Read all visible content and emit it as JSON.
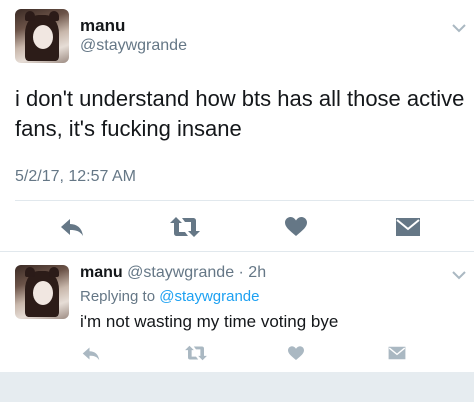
{
  "main_tweet": {
    "author_name": "manu",
    "author_handle": "@staywgrande",
    "text": "i don't understand how bts has all those active fans, it's fucking insane",
    "timestamp": "5/2/17, 12:57 AM"
  },
  "reply_tweet": {
    "author_name": "manu",
    "meta": "@staywgrande · 2h",
    "replying_prefix": "Replying to",
    "replying_to": "@staywgrande",
    "text": "i'm not wasting my time voting bye"
  },
  "icons": {
    "reply": "reply-icon",
    "retweet": "retweet-icon",
    "like": "heart-icon",
    "dm": "envelope-icon",
    "menu": "chevron-down-icon"
  },
  "colors": {
    "icon": "#657786",
    "text": "#14171a",
    "muted": "#657786",
    "link": "#1da1f2",
    "divider": "#e1e8ed"
  }
}
